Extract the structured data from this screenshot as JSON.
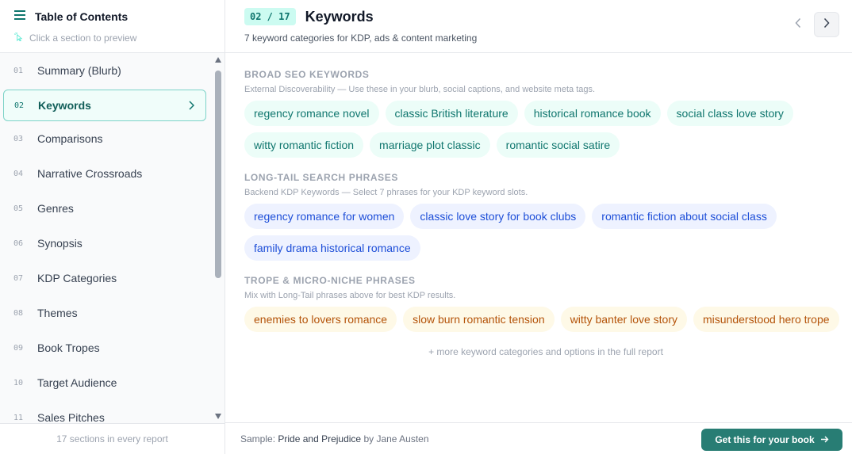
{
  "sidebar": {
    "title": "Table of Contents",
    "hint": "Click a section to preview",
    "items": [
      {
        "num": "01",
        "label": "Summary (Blurb)"
      },
      {
        "num": "02",
        "label": "Keywords"
      },
      {
        "num": "03",
        "label": "Comparisons"
      },
      {
        "num": "04",
        "label": "Narrative Crossroads"
      },
      {
        "num": "05",
        "label": "Genres"
      },
      {
        "num": "06",
        "label": "Synopsis"
      },
      {
        "num": "07",
        "label": "KDP Categories"
      },
      {
        "num": "08",
        "label": "Themes"
      },
      {
        "num": "09",
        "label": "Book Tropes"
      },
      {
        "num": "10",
        "label": "Target Audience"
      },
      {
        "num": "11",
        "label": "Sales Pitches"
      }
    ],
    "footer": "17 sections in every report"
  },
  "header": {
    "badge": "02 / 17",
    "title": "Keywords",
    "subtitle": "7 keyword categories for KDP, ads & content marketing"
  },
  "sections": [
    {
      "title": "BROAD SEO KEYWORDS",
      "desc": "External Discoverability — Use these in your blurb, social captions, and website meta tags.",
      "chips": [
        "regency romance novel",
        "classic British literature",
        "historical romance book",
        "social class love story",
        "witty romantic fiction",
        "marriage plot classic",
        "romantic social satire"
      ]
    },
    {
      "title": "LONG-TAIL SEARCH PHRASES",
      "desc": "Backend KDP Keywords — Select 7 phrases for your KDP keyword slots.",
      "chips": [
        "regency romance for women",
        "classic love story for book clubs",
        "romantic fiction about social class",
        "family drama historical romance"
      ]
    },
    {
      "title": "TROPE & MICRO-NICHE PHRASES",
      "desc": "Mix with Long-Tail phrases above for best KDP results.",
      "chips": [
        "enemies to lovers romance",
        "slow burn romantic tension",
        "witty banter love story",
        "misunderstood hero trope"
      ]
    }
  ],
  "more_text": "+ more keyword categories and options in the full report",
  "footer": {
    "sample_prefix": "Sample:",
    "book": "Pride and Prejudice",
    "by": "by Jane Austen",
    "cta": "Get this for your book"
  },
  "icons": {
    "menu": "menu-icon",
    "cursor": "pointer-click-icon",
    "prev": "chevron-left-icon",
    "next": "chevron-right-icon",
    "arrow": "arrow-right-icon"
  },
  "colors": {
    "accent": "#287d74",
    "teal_chip": "#ecfdf8",
    "blue_chip": "#eef2ff",
    "amber_chip": "#fef9e7"
  }
}
